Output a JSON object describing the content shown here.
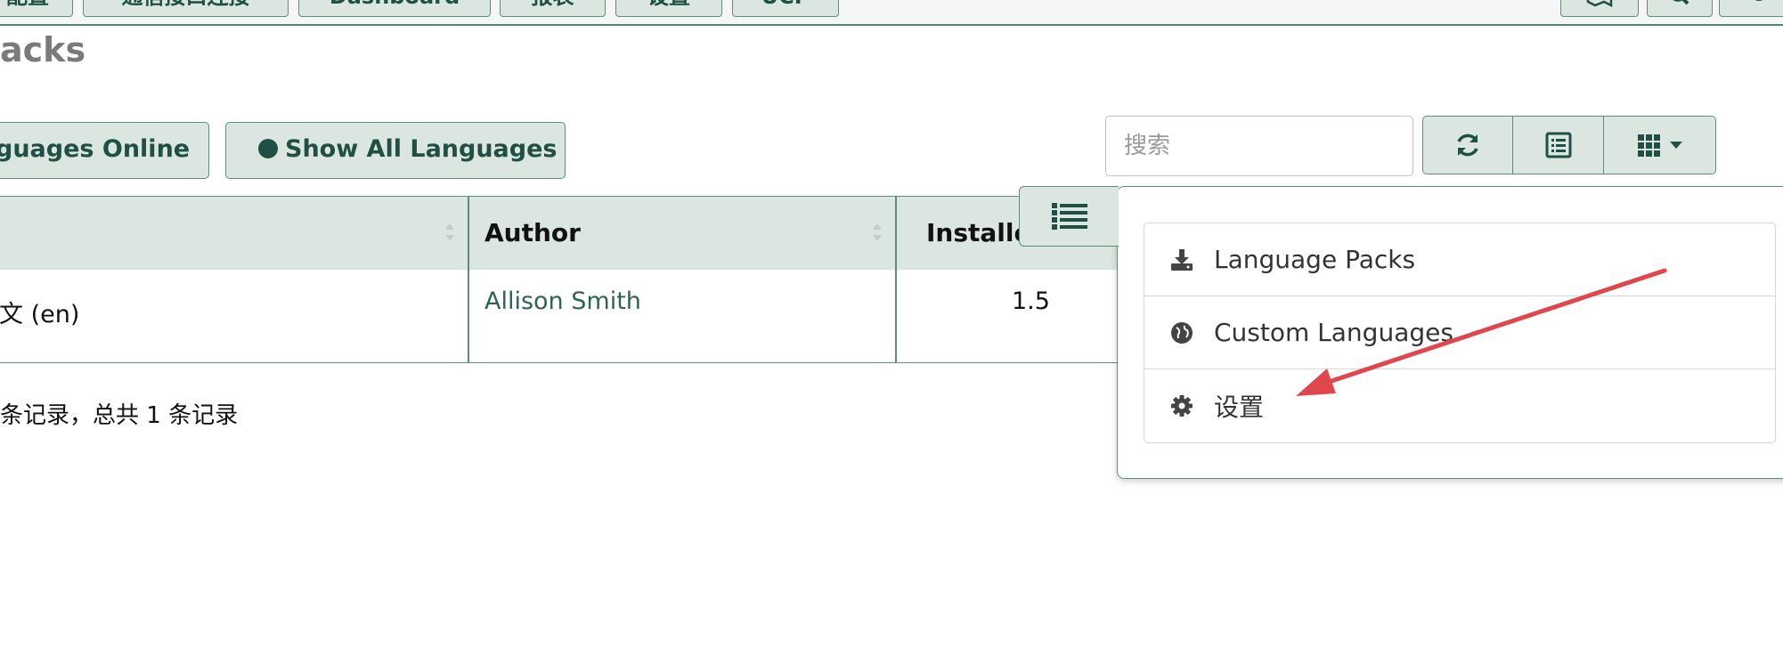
{
  "nav": {
    "tabs": [
      {
        "label": "配置"
      },
      {
        "label": "通信接口连接"
      },
      {
        "label": "Dashboard"
      },
      {
        "label": "报表"
      },
      {
        "label": "设置"
      },
      {
        "label": "UCP"
      }
    ]
  },
  "page": {
    "title": "acks"
  },
  "toolbar": {
    "online_label": "guages Online",
    "show_all_label": "Show All Languages",
    "search_placeholder": "搜索"
  },
  "table": {
    "headers": [
      "Author",
      "Installe"
    ],
    "rows": [
      {
        "name": "文 (en)",
        "author": "Allison Smith",
        "installed": "1.5"
      }
    ],
    "record_count": "条记录，总共 1 条记录"
  },
  "dropdown": {
    "items": [
      {
        "label": "Language Packs",
        "icon": "download-icon"
      },
      {
        "label": "Custom Languages",
        "icon": "globe-icon"
      },
      {
        "label": "设置",
        "icon": "gear-icon"
      }
    ]
  },
  "colors": {
    "accent": "#1f4f45",
    "button_bg": "#dce6e0",
    "border": "#5a8f78",
    "annotation_arrow": "#e0474c"
  }
}
